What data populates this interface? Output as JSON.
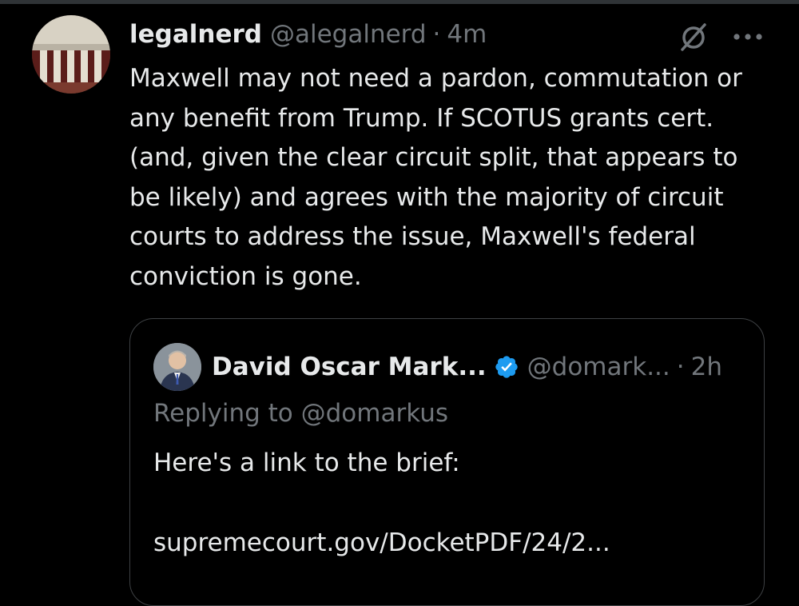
{
  "tweet": {
    "author_name": "legalnerd",
    "author_handle": "@alegalnerd",
    "separator": "·",
    "timestamp": "4m",
    "text": "Maxwell may not need a pardon, commutation or any benefit from Trump. If SCOTUS grants cert. (and, given the clear circuit split, that appears to be likely) and agrees with the majority of circuit courts to address the issue, Maxwell's federal conviction is gone.",
    "avatar_icon": "courthouse-avatar",
    "action_icons": [
      "grok-icon",
      "more-options-icon"
    ]
  },
  "quote": {
    "author_name": "David Oscar Mark...",
    "verified_icon": "verified-badge-icon",
    "author_handle": "@domark...",
    "separator": "·",
    "timestamp": "2h",
    "replying_to": "Replying to @domarkus",
    "text": "Here's a link to the brief:",
    "link": "supremecourt.gov/DocketPDF/24/2..."
  },
  "colors": {
    "background": "#000000",
    "text_primary": "#e7e9ea",
    "text_secondary": "#71767b",
    "verified_blue": "#1d9bf0",
    "card_border": "#3e4144"
  }
}
